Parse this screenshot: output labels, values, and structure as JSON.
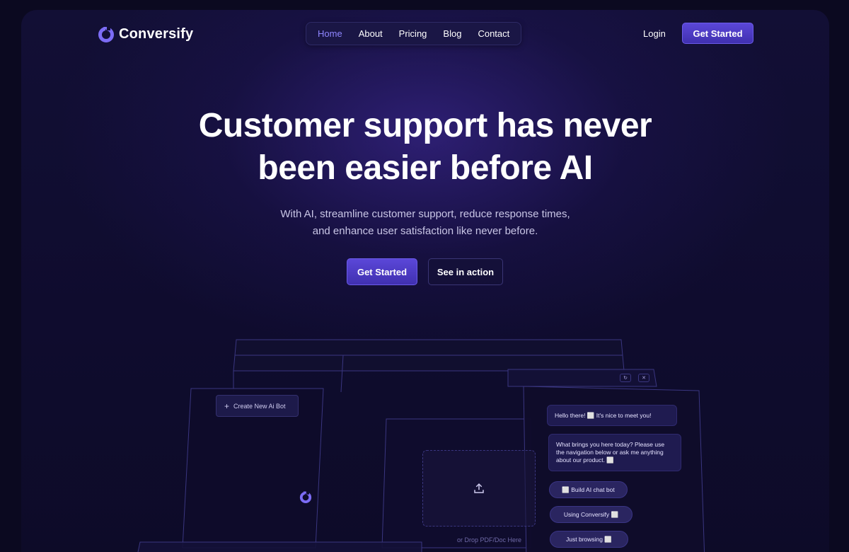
{
  "brand": {
    "name": "Conversify",
    "accent": "#6b5bea"
  },
  "nav": {
    "links": [
      "Home",
      "About",
      "Pricing",
      "Blog",
      "Contact"
    ],
    "active": "Home",
    "login_label": "Login",
    "cta_label": "Get Started"
  },
  "hero": {
    "headline_line1": "Customer support has never",
    "headline_line2": "been easier before AI",
    "subtitle_line1": "With AI, streamline customer support, reduce response times,",
    "subtitle_line2": "and enhance user satisfaction like never before.",
    "primary_cta": "Get Started",
    "secondary_cta": "See in action"
  },
  "illustration": {
    "create_bot_label": "Create New Ai Bot",
    "upload_hint": "or Drop PDF/Doc Here",
    "window_controls": [
      "refresh-icon",
      "close-icon"
    ],
    "chat": {
      "greeting": "Hello there! ⬜ It's nice to meet you!",
      "prompt": "What brings you here today? Please use the navigation below or ask me anything about our product. ⬜",
      "options": [
        "⬜ Build AI chat bot",
        "Using Conversify ⬜",
        "Just browsing ⬜"
      ]
    }
  }
}
